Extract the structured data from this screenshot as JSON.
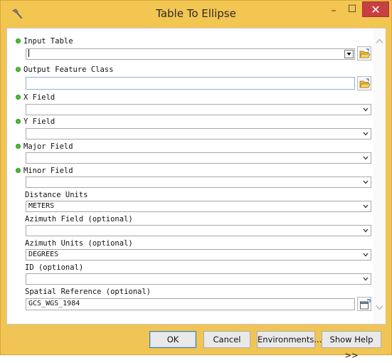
{
  "window": {
    "title": "Table To Ellipse",
    "minimize_glyph": "–",
    "maximize_glyph": "☐",
    "close_glyph": "✕"
  },
  "form": {
    "input_table": {
      "label": "Input Table",
      "value": "",
      "required": true
    },
    "output_feature_class": {
      "label": "Output Feature Class",
      "value": "",
      "required": true
    },
    "x_field": {
      "label": "X Field",
      "value": "",
      "required": true
    },
    "y_field": {
      "label": "Y Field",
      "value": "",
      "required": true
    },
    "major_field": {
      "label": "Major Field",
      "value": "",
      "required": true
    },
    "minor_field": {
      "label": "Minor Field",
      "value": "",
      "required": true
    },
    "distance_units": {
      "label": "Distance Units",
      "value": "METERS",
      "required": false
    },
    "azimuth_field": {
      "label": "Azimuth Field (optional)",
      "value": "",
      "required": false
    },
    "azimuth_units": {
      "label": "Azimuth Units (optional)",
      "value": "DEGREES",
      "required": false
    },
    "id_field": {
      "label": "ID (optional)",
      "value": "",
      "required": false
    },
    "spatial_reference": {
      "label": "Spatial Reference (optional)",
      "value": "GCS_WGS_1984",
      "required": false
    }
  },
  "buttons": {
    "ok": "OK",
    "cancel": "Cancel",
    "environments": "Environments...",
    "show_help": "Show Help >>"
  },
  "icons": {
    "title": "hammer-icon",
    "browse": "open-folder-icon",
    "spatial_reference": "spatial-reference-properties-icon",
    "required_marker": "green-dot-icon"
  },
  "colors": {
    "title_bar": "#f3c551",
    "close_button": "#c74041",
    "required_dot": "#4fbf2f",
    "active_field_border": "#89b2d8"
  }
}
